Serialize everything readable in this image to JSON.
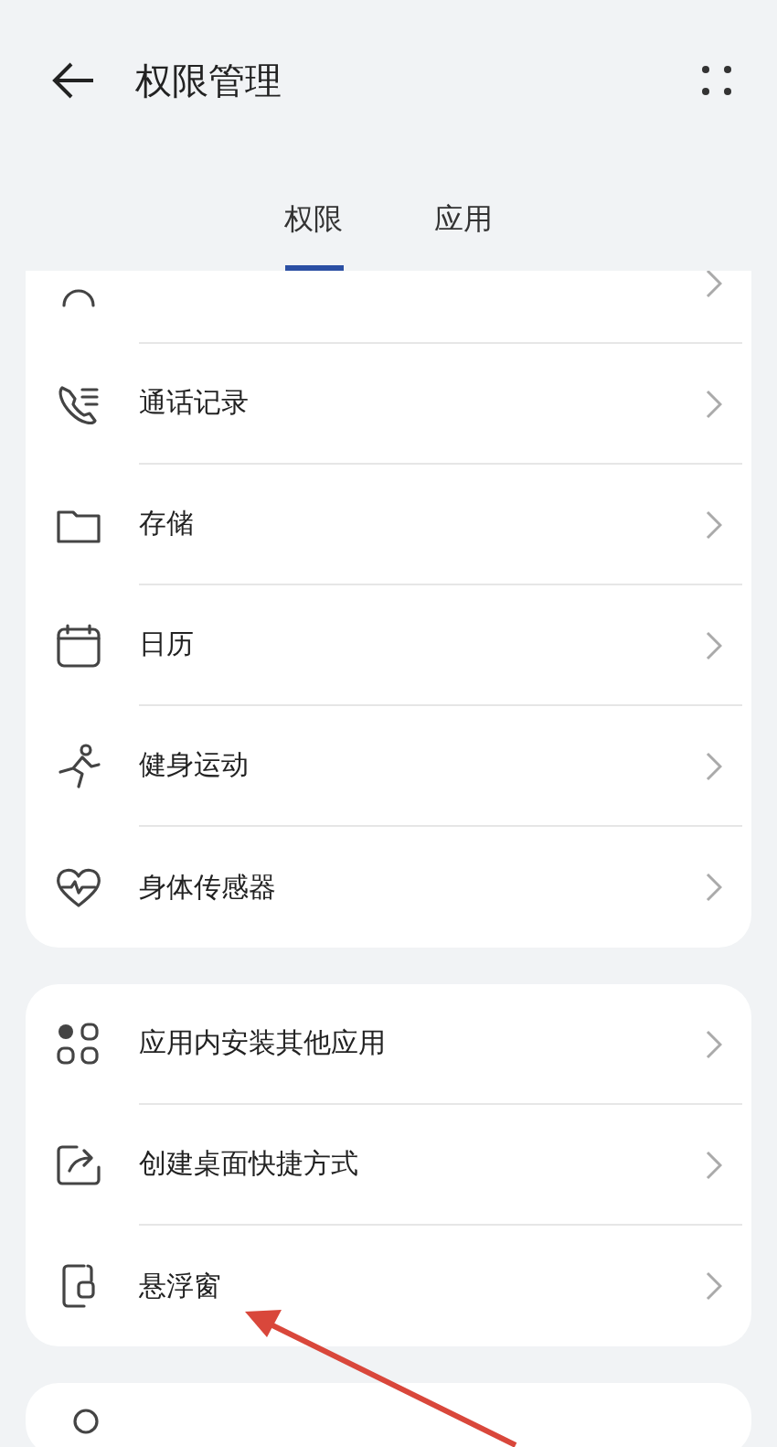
{
  "header": {
    "title": "权限管理"
  },
  "tabs": [
    {
      "label": "权限",
      "selected": true
    },
    {
      "label": "应用",
      "selected": false
    }
  ],
  "groups": [
    {
      "clipped_top": true,
      "items": [
        {
          "label": "通话记录"
        },
        {
          "label": "存储"
        },
        {
          "label": "日历"
        },
        {
          "label": "健身运动"
        },
        {
          "label": "身体传感器"
        }
      ]
    },
    {
      "items": [
        {
          "label": "应用内安装其他应用"
        },
        {
          "label": "创建桌面快捷方式"
        },
        {
          "label": "悬浮窗"
        }
      ]
    },
    {
      "clipped_bottom": true
    }
  ]
}
